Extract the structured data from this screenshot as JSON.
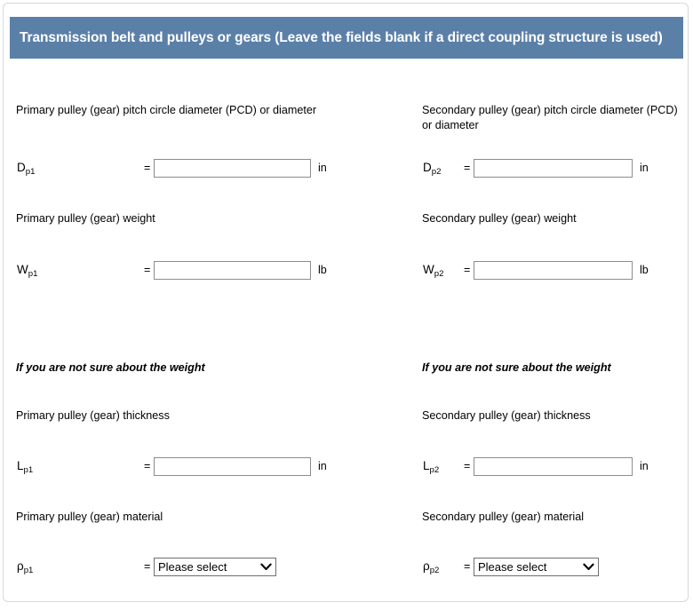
{
  "panel": {
    "header_title": "Transmission belt and pulleys or gears (Leave the fields blank if a direct coupling structure is used)",
    "header_color": "#5b80a8",
    "header_text_color": "#ffffff"
  },
  "columns": {
    "left": {
      "fields": [
        {
          "description": "Primary pulley (gear) pitch circle diameter (PCD) or diameter",
          "symbol": "D",
          "subscript": "p1",
          "equals": "=",
          "value": "",
          "placeholder": "",
          "unit": "in",
          "control": "text"
        },
        {
          "description": "Primary pulley (gear) weight",
          "symbol": "W",
          "subscript": "p1",
          "equals": "=",
          "value": "",
          "placeholder": "",
          "unit": "lb",
          "control": "text"
        },
        {
          "description": "Primary pulley (gear) thickness",
          "symbol": "L",
          "subscript": "p1",
          "equals": "=",
          "value": "",
          "placeholder": "",
          "unit": "in",
          "control": "text"
        },
        {
          "description": "Primary pulley (gear) material",
          "symbol": "ρ",
          "subscript": "p1",
          "equals": "=",
          "value": "Please select",
          "unit": "",
          "control": "select"
        }
      ],
      "note": "If you are not sure about the weight"
    },
    "right": {
      "fields": [
        {
          "description": "Secondary pulley (gear) pitch circle diameter (PCD) or diameter",
          "symbol": "D",
          "subscript": "p2",
          "equals": "=",
          "value": "",
          "placeholder": "",
          "unit": "in",
          "control": "text"
        },
        {
          "description": "Secondary pulley (gear) weight",
          "symbol": "W",
          "subscript": "p2",
          "equals": "=",
          "value": "",
          "placeholder": "",
          "unit": "lb",
          "control": "text"
        },
        {
          "description": "Secondary pulley (gear) thickness",
          "symbol": "L",
          "subscript": "p2",
          "equals": "=",
          "value": "",
          "placeholder": "",
          "unit": "in",
          "control": "text"
        },
        {
          "description": "Secondary pulley (gear) material",
          "symbol": "ρ",
          "subscript": "p2",
          "equals": "=",
          "value": "Please select",
          "unit": "",
          "control": "select"
        }
      ],
      "note": "If you are not sure about the weight"
    }
  },
  "icons": {
    "chevron_down": "chevron-down-icon"
  }
}
